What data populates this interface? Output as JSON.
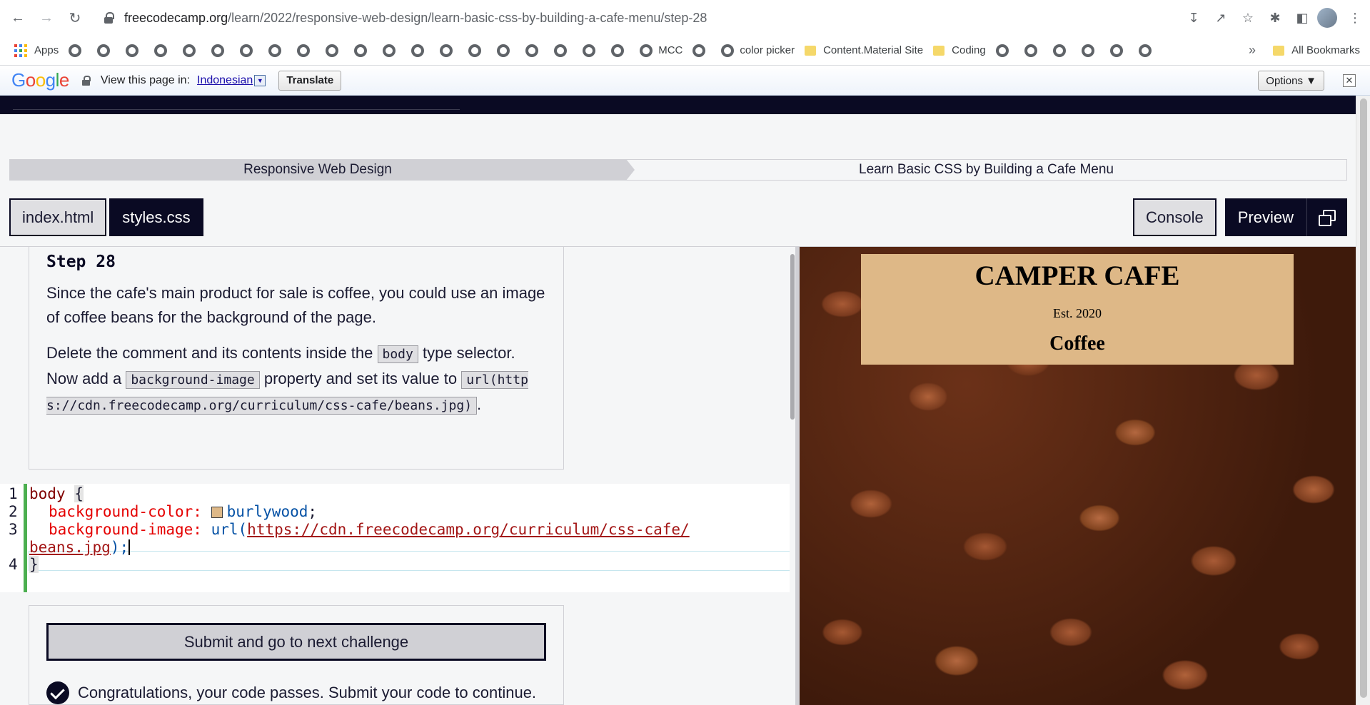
{
  "browser": {
    "url_host": "freecodecamp.org",
    "url_path": "/learn/2022/responsive-web-design/learn-basic-css-by-building-a-cafe-menu/step-28",
    "bookmarks": {
      "apps_label": "Apps",
      "mcc_label": "MCC",
      "color_picker_label": "color picker",
      "content_material_label": "Content.Material Site",
      "coding_label": "Coding",
      "all_bookmarks_label": "All Bookmarks"
    }
  },
  "translate_bar": {
    "prompt": "View this page in:",
    "language": "Indonesian",
    "translate_label": "Translate",
    "options_label": "Options ▼"
  },
  "breadcrumb": {
    "superblock": "Responsive Web Design",
    "block": "Learn Basic CSS by Building a Cafe Menu"
  },
  "editor_tabs": {
    "html_tab": "index.html",
    "css_tab": "styles.css",
    "console_label": "Console",
    "preview_label": "Preview"
  },
  "instructions": {
    "title": "Step 28",
    "p1": "Since the cafe's main product for sale is coffee, you could use an image of coffee beans for the background of the page.",
    "p2_a": "Delete the comment and its contents inside the",
    "p2_code1": "body",
    "p2_b": "type selector. Now add a",
    "p2_code2": "background-image",
    "p2_c": "property and set its value to",
    "p2_code3": "url(https://cdn.freecodecamp.org/curriculum/css-cafe/beans.jpg)",
    "p2_end": "."
  },
  "code": {
    "lines": [
      "1",
      "2",
      "3",
      "4"
    ],
    "selector": "body",
    "open_brace": "{",
    "close_brace": "}",
    "prop1": "background-color:",
    "val1": "burlywood",
    "prop2": "background-image:",
    "fn2": "url(",
    "url_part1": "https://cdn.freecodecamp.org/curriculum/css-cafe/",
    "url_part2": "beans.jpg",
    "close2": ");",
    "semicolon": ";"
  },
  "submit": {
    "button_label": "Submit and go to next challenge",
    "pass_message": "Congratulations, your code passes. Submit your code to continue."
  },
  "preview_page": {
    "title": "CAMPER CAFE",
    "est": "Est. 2020",
    "section": "Coffee"
  },
  "colors": {
    "fcc_dark": "#0a0a23",
    "burlywood": "#deb887",
    "gutter_pass": "#4caf50"
  }
}
